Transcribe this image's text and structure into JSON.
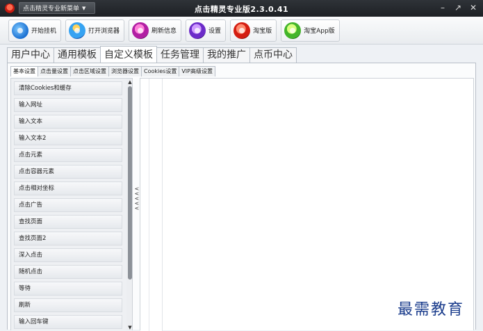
{
  "window": {
    "title": "点击精灵专业版2.3.0.41",
    "menu_button": "点击精灵专业新菜单",
    "controls": [
      "–",
      "↗",
      "✕"
    ]
  },
  "toolbar": {
    "buttons": [
      {
        "label": "开始挂机",
        "icon": "start-icon"
      },
      {
        "label": "打开浏览器",
        "icon": "browser-icon"
      },
      {
        "label": "刷新信息",
        "icon": "refresh-icon"
      },
      {
        "label": "设置",
        "icon": "settings-icon"
      },
      {
        "label": "淘宝版",
        "icon": "taobao-icon"
      },
      {
        "label": "淘宝App版",
        "icon": "taobao-app-icon"
      }
    ]
  },
  "main_tabs": [
    {
      "label": "用户中心",
      "active": false
    },
    {
      "label": "通用模板",
      "active": false
    },
    {
      "label": "自定义模板",
      "active": true
    },
    {
      "label": "任务管理",
      "active": false
    },
    {
      "label": "我的推广",
      "active": false
    },
    {
      "label": "点币中心",
      "active": false
    }
  ],
  "sub_tabs": [
    {
      "label": "基本设置",
      "active": true
    },
    {
      "label": "点击量设置",
      "active": false
    },
    {
      "label": "点击区域设置",
      "active": false
    },
    {
      "label": "浏览器设置",
      "active": false
    },
    {
      "label": "Cookies设置",
      "active": false
    },
    {
      "label": "VIP高级设置",
      "active": false
    }
  ],
  "command_list": [
    "清除Cookies和缓存",
    "输入网址",
    "输入文本",
    "输入文本2",
    "点击元素",
    "点击容器元素",
    "点击相对坐标",
    "点击广告",
    "查找页面",
    "查找页面2",
    "深入点击",
    "随机点击",
    "等待",
    "刷新",
    "输入回车键"
  ],
  "splitter": {
    "arrows": "<\n<\n<\n<\n<"
  },
  "watermark": "最需教育"
}
